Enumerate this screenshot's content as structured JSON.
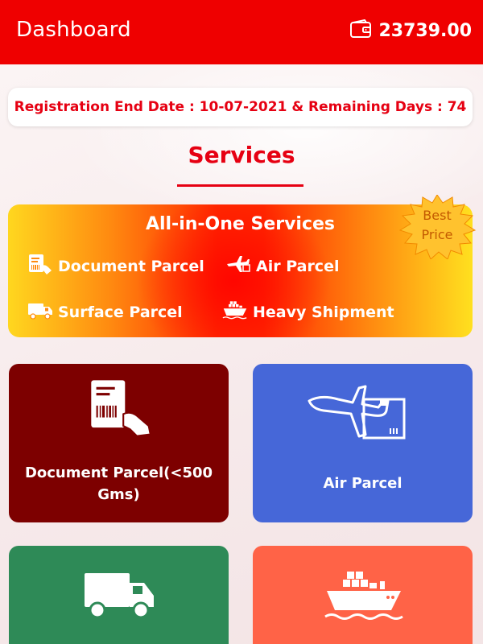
{
  "header": {
    "title": "Dashboard",
    "wallet_icon": "wallet-icon",
    "balance": "23739.00",
    "color": "#ef0000"
  },
  "registration": {
    "text": "Registration End Date : 10-07-2021 & Remaining Days : 74"
  },
  "services": {
    "title": "Services"
  },
  "all_in_one": {
    "title": "All-in-One Services",
    "badge_line1": "Best",
    "badge_line2": "Price",
    "items": [
      {
        "label": "Document Parcel",
        "icon": "document-parcel-icon"
      },
      {
        "label": "Air Parcel",
        "icon": "airplane-icon"
      },
      {
        "label": "Surface Parcel",
        "icon": "truck-icon"
      },
      {
        "label": "Heavy Shipment",
        "icon": "cargo-ship-icon"
      }
    ]
  },
  "cards": [
    {
      "label": "Document Parcel(<500 Gms)",
      "color": "#7d0000",
      "icon": "document-parcel-icon"
    },
    {
      "label": "Air Parcel",
      "color": "#4667d8",
      "icon": "airplane-icon"
    },
    {
      "label": "",
      "color": "#2e8a57",
      "icon": "truck-icon"
    },
    {
      "label": "",
      "color": "#ff6347",
      "icon": "cargo-ship-icon"
    }
  ]
}
